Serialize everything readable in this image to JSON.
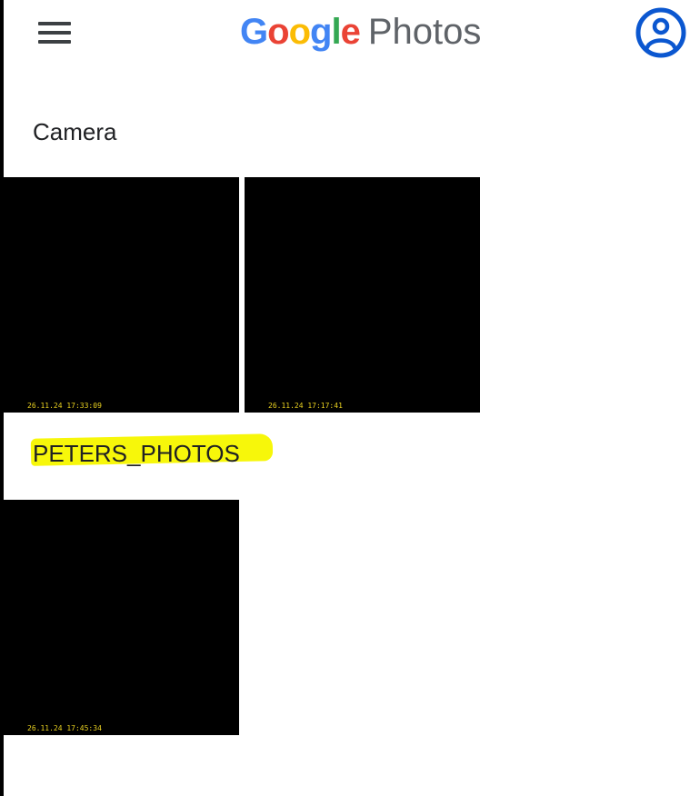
{
  "header": {
    "menu_icon": "hamburger-menu-icon",
    "logo": {
      "letters": [
        {
          "char": "G",
          "color": "#4285F4"
        },
        {
          "char": "o",
          "color": "#EA4335"
        },
        {
          "char": "o",
          "color": "#FBBC05"
        },
        {
          "char": "g",
          "color": "#4285F4"
        },
        {
          "char": "l",
          "color": "#34A853"
        },
        {
          "char": "e",
          "color": "#EA4335"
        }
      ],
      "product": "Photos"
    },
    "account_icon": "account-circle-icon",
    "account_color": "#0b57d0"
  },
  "sections": [
    {
      "title": "Camera",
      "photos": [
        {
          "timestamp": "26.11.24 17:33:09"
        },
        {
          "timestamp": "26.11.24 17:17:41"
        }
      ]
    },
    {
      "title": "PETERS_PHOTOS",
      "highlight_color": "#f7f70a",
      "photos": [
        {
          "timestamp": "26.11.24 17:45:34"
        }
      ]
    }
  ]
}
